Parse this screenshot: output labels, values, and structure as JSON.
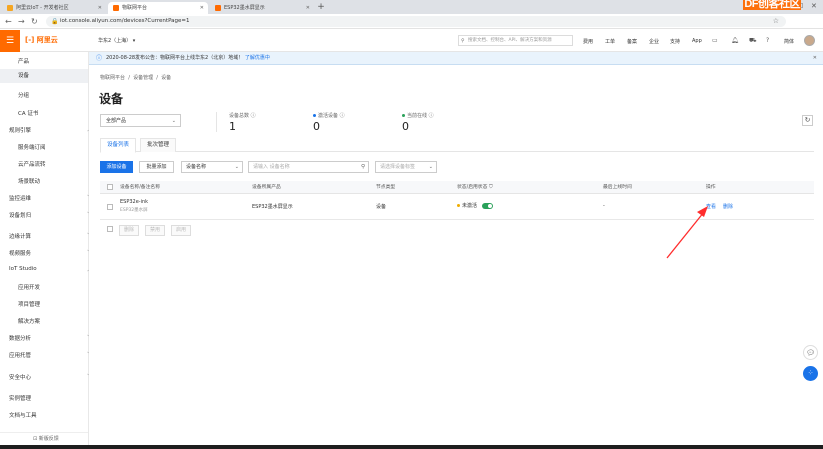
{
  "browser": {
    "tabs": [
      {
        "label": "阿里云IoT - 开发者社区",
        "color": "#f5a623"
      },
      {
        "label": "物联网平台",
        "color": "#ff6a00"
      },
      {
        "label": "ESP32墨水屏显示",
        "color": "#ff6a00"
      }
    ],
    "new_tab": "+",
    "url": "iot.console.aliyun.com/devices?CurrentPage=1",
    "watermark": "DF创客社区"
  },
  "topbar": {
    "brand": "阿里云",
    "region": "华东2（上海）",
    "search_placeholder": "搜索文档、控制台、API、解决方案和资源",
    "menu": [
      "费用",
      "工单",
      "备案",
      "企业",
      "支持",
      "App"
    ],
    "lang": "简体"
  },
  "sidebar": {
    "items": [
      {
        "label": "产品",
        "level": "sub"
      },
      {
        "label": "设备",
        "level": "sub",
        "active": true
      },
      {
        "label": "分组",
        "level": "sub"
      },
      {
        "label": "CA 证书",
        "level": "sub"
      },
      {
        "label": "规则引擎",
        "level": "top",
        "expandable": true
      },
      {
        "label": "服务端订阅",
        "level": "sub"
      },
      {
        "label": "云产品流转",
        "level": "sub"
      },
      {
        "label": "场景联动",
        "level": "sub"
      },
      {
        "label": "监控运维",
        "level": "top",
        "expandable": true
      },
      {
        "label": "设备划归",
        "level": "top",
        "expandable": true
      },
      {
        "label": "边缘计算",
        "level": "top",
        "expandable": true
      },
      {
        "label": "视频服务",
        "level": "top",
        "expandable": true
      },
      {
        "label": "IoT Studio",
        "level": "top",
        "expandable": true
      },
      {
        "label": "应用开发",
        "level": "sub"
      },
      {
        "label": "项目管理",
        "level": "sub"
      },
      {
        "label": "解决方案",
        "level": "sub"
      },
      {
        "label": "数据分析",
        "level": "top",
        "expandable": true
      },
      {
        "label": "应用托管",
        "level": "top",
        "expandable": true
      },
      {
        "label": "安全中心",
        "level": "top",
        "expandable": true
      },
      {
        "label": "实例管理",
        "level": "top"
      },
      {
        "label": "文档与工具",
        "level": "top"
      }
    ],
    "footer": "新版反馈"
  },
  "notice": {
    "text": "2020-08-28发布公告：物联网平台上线华东2（北京）地域！",
    "link": "了解优惠中"
  },
  "breadcrumb": [
    "物联网平台",
    "设备管理",
    "设备"
  ],
  "page_title": "设备",
  "product_filter": "全部产品",
  "stats": [
    {
      "label": "设备总数",
      "value": "1",
      "dot": ""
    },
    {
      "label": "激活设备",
      "value": "0",
      "dot": "#1a73e8"
    },
    {
      "label": "当前在线",
      "value": "0",
      "dot": "#2aa15a"
    }
  ],
  "tabs": [
    "设备列表",
    "批次管理"
  ],
  "toolbar": {
    "add": "添加设备",
    "batch_add": "批量添加",
    "search_type": "设备名称",
    "search_placeholder": "请输入 设备名称",
    "tag_filter": "请选择设备标签"
  },
  "table": {
    "headers": [
      "设备名称/备注名称",
      "设备所属产品",
      "节点类型",
      "状态/启用状态",
      "最后上线时间",
      "操作"
    ],
    "rows": [
      {
        "name": "ESP32e-ink",
        "note": "ESP32墨水屏",
        "product": "ESP32墨水屏显示",
        "node_type": "设备",
        "status": "未激活",
        "enabled": true,
        "last_online": "-",
        "actions": [
          "查看",
          "删除"
        ]
      }
    ]
  },
  "bulk_actions": [
    "删除",
    "禁用",
    "启用"
  ],
  "colors": {
    "brand": "#ff6a00",
    "primary": "#1a73e8",
    "annotation": "#ff2d2d"
  }
}
